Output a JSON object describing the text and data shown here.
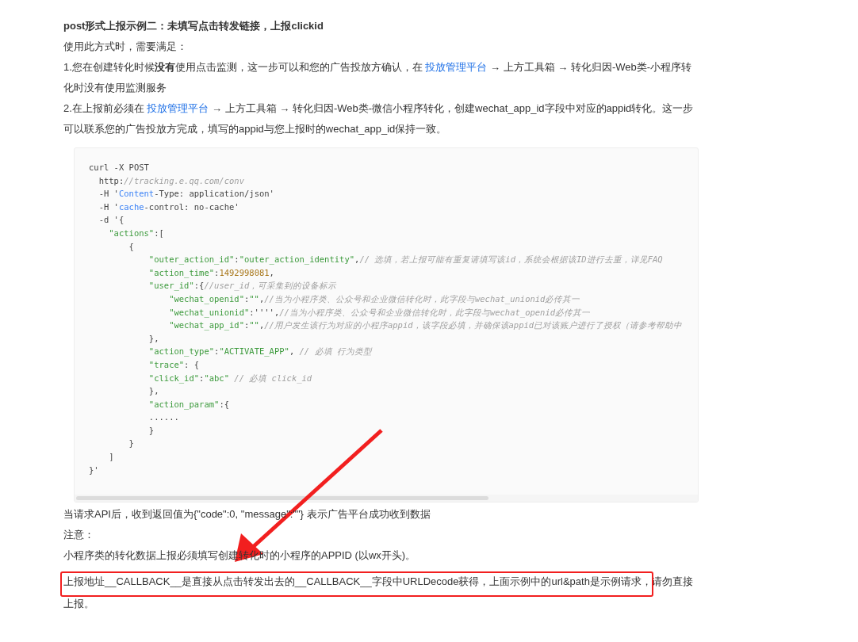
{
  "heading": "post形式上报示例二：未填写点击转发链接，上报clickid",
  "intro_paragraphs": [
    {
      "parts": [
        {
          "kind": "text",
          "text": "使用此方式时，需要满足："
        }
      ]
    },
    {
      "parts": [
        {
          "kind": "text",
          "text": "1.您在创建转化时候**没有**使用点击监测，这一步可以和您的广告投放方确认，在 "
        },
        {
          "kind": "link",
          "text": "投放管理平台"
        },
        {
          "kind": "text",
          "text": " → 上方工具箱 → 转化归因-Web类-小程序转化时没有使用监测服务"
        }
      ]
    },
    {
      "parts": [
        {
          "kind": "text",
          "text": "2.在上报前必须在 "
        },
        {
          "kind": "link",
          "text": "投放管理平台"
        },
        {
          "kind": "text",
          "text": " → 上方工具箱 → 转化归因-Web类-微信小程序转化，创建wechat_app_id字段中对应的appid转化。这一步可以联系您的广告投放方完成，填写的appid与您上报时的wechat_app_id保持一致。"
        }
      ]
    }
  ],
  "code_lines": [
    [
      {
        "kind": "plain",
        "text": "curl -X POST"
      }
    ],
    [
      {
        "kind": "plain",
        "text": "  http:"
      },
      {
        "kind": "comment",
        "text": "//tracking.e.qq.com/conv"
      }
    ],
    [
      {
        "kind": "plain",
        "text": "  -H '"
      },
      {
        "kind": "keyword",
        "text": "Content"
      },
      {
        "kind": "plain",
        "text": "-Type: application/json'"
      }
    ],
    [
      {
        "kind": "plain",
        "text": "  -H '"
      },
      {
        "kind": "keyword",
        "text": "cache"
      },
      {
        "kind": "plain",
        "text": "-control: no-cache'"
      }
    ],
    [
      {
        "kind": "plain",
        "text": "  -d '{"
      }
    ],
    [
      {
        "kind": "string",
        "text": "    \"actions\""
      },
      {
        "kind": "plain",
        "text": ":["
      }
    ],
    [
      {
        "kind": "plain",
        "text": "        {"
      }
    ],
    [
      {
        "kind": "string",
        "text": "            \"outer_action_id\""
      },
      {
        "kind": "plain",
        "text": ":"
      },
      {
        "kind": "string",
        "text": "\"outer_action_identity\""
      },
      {
        "kind": "plain",
        "text": ","
      },
      {
        "kind": "comment",
        "text": "// 选填，若上报可能有重复请填写该id，系统会根据该ID进行去重，详见FAQ"
      }
    ],
    [
      {
        "kind": "string",
        "text": "            \"action_time\""
      },
      {
        "kind": "plain",
        "text": ":"
      },
      {
        "kind": "number",
        "text": "1492998081"
      },
      {
        "kind": "plain",
        "text": ","
      }
    ],
    [
      {
        "kind": "string",
        "text": "            \"user_id\""
      },
      {
        "kind": "plain",
        "text": ":{"
      },
      {
        "kind": "comment",
        "text": "//user_id，可采集到的设备标示"
      }
    ],
    [
      {
        "kind": "string",
        "text": "                \"wechat_openid\""
      },
      {
        "kind": "plain",
        "text": ":"
      },
      {
        "kind": "string",
        "text": "\"\""
      },
      {
        "kind": "plain",
        "text": ","
      },
      {
        "kind": "comment",
        "text": "//当为小程序类、公众号和企业微信转化时，此字段与wechat_unionid必传其一"
      }
    ],
    [
      {
        "kind": "string",
        "text": "                \"wechat_unionid\""
      },
      {
        "kind": "plain",
        "text": ":'''',"
      },
      {
        "kind": "comment",
        "text": "//当为小程序类、公众号和企业微信转化时，此字段与wechat_openid必传其一"
      }
    ],
    [
      {
        "kind": "string",
        "text": "                \"wechat_app_id\""
      },
      {
        "kind": "plain",
        "text": ":"
      },
      {
        "kind": "string",
        "text": "\"\""
      },
      {
        "kind": "plain",
        "text": ","
      },
      {
        "kind": "comment",
        "text": "//用户发生该行为对应的小程序appid，该字段必填，并确保该appid已对该账户进行了授权（请参考帮助中"
      }
    ],
    [
      {
        "kind": "plain",
        "text": "            },"
      }
    ],
    [
      {
        "kind": "string",
        "text": "            \"action_type\""
      },
      {
        "kind": "plain",
        "text": ":"
      },
      {
        "kind": "string",
        "text": "\"ACTIVATE_APP\""
      },
      {
        "kind": "plain",
        "text": ", "
      },
      {
        "kind": "comment",
        "text": "// 必填 行为类型"
      }
    ],
    [
      {
        "kind": "string",
        "text": "            \"trace\""
      },
      {
        "kind": "plain",
        "text": ": {"
      }
    ],
    [
      {
        "kind": "string",
        "text": "            \"click_id\""
      },
      {
        "kind": "plain",
        "text": ":"
      },
      {
        "kind": "string",
        "text": "\"abc\""
      },
      {
        "kind": "comment",
        "text": " // 必填 click_id"
      }
    ],
    [
      {
        "kind": "plain",
        "text": "            },"
      }
    ],
    [
      {
        "kind": "string",
        "text": "            \"action_param\""
      },
      {
        "kind": "plain",
        "text": ":{"
      }
    ],
    [
      {
        "kind": "plain",
        "text": "            ......"
      }
    ],
    [
      {
        "kind": "plain",
        "text": "            }"
      }
    ],
    [
      {
        "kind": "plain",
        "text": "        }"
      }
    ],
    [
      {
        "kind": "plain",
        "text": "    ]"
      }
    ],
    [
      {
        "kind": "plain",
        "text": "}'"
      }
    ]
  ],
  "after_paragraphs": [
    {
      "parts": [
        {
          "kind": "text",
          "text": "当请求API后，收到返回值为{\"code\":0, \"message\":\"\"} 表示广告平台成功收到数据"
        }
      ],
      "highlighted": false
    },
    {
      "parts": [
        {
          "kind": "text",
          "text": "注意："
        }
      ],
      "highlighted": false
    },
    {
      "parts": [
        {
          "kind": "text",
          "text": "小程序类的转化数据上报必须填写创建转化时的小程序的APPID (以wx开头)。"
        }
      ],
      "highlighted": false
    },
    {
      "parts": [
        {
          "kind": "text",
          "text": "上报地址__CALLBACK__是直接从点击转发出去的__CALLBACK__字段中URLDecode获得，上面示例中的url&path是示例请求，请勿直接上报。"
        }
      ],
      "highlighted": true
    }
  ]
}
